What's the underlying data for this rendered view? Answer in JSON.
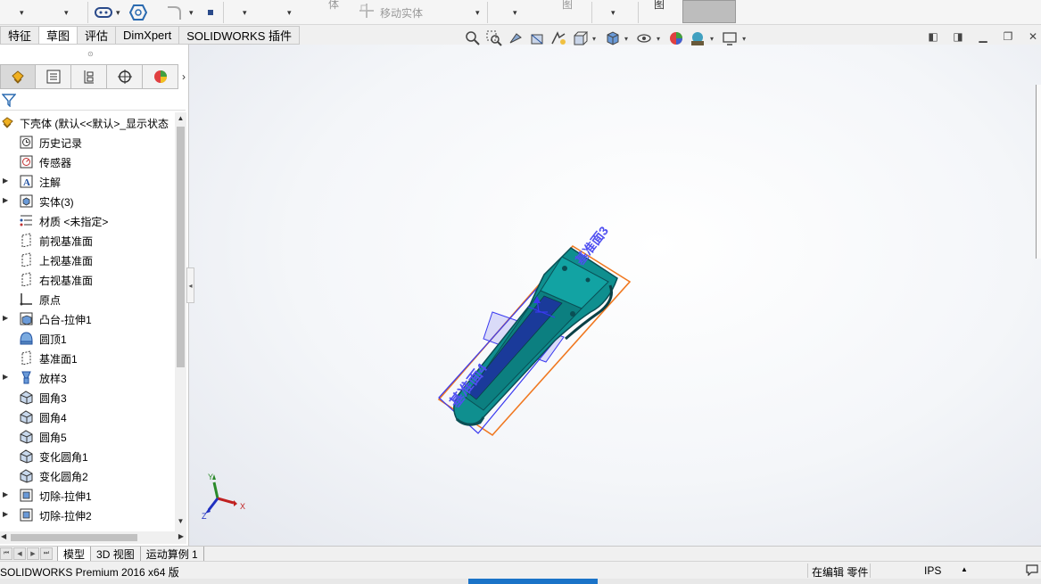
{
  "top_toolbar": {
    "move_body_label": "移动实体",
    "faded_label_1": "体",
    "faded_label_2": "图",
    "faded_label_3": "图"
  },
  "command_tabs": [
    "特征",
    "草图",
    "评估",
    "DimXpert",
    "SOLIDWORKS 插件"
  ],
  "active_command_tab": "草图",
  "feature_tree": {
    "root": "下壳体 (默认<<默认>_显示状态",
    "items": [
      {
        "label": "历史记录",
        "icon": "history-icon",
        "expandable": false
      },
      {
        "label": "传感器",
        "icon": "sensor-icon",
        "expandable": false
      },
      {
        "label": "注解",
        "icon": "annotation-icon",
        "expandable": true
      },
      {
        "label": "实体(3)",
        "icon": "solid-bodies-icon",
        "expandable": true
      },
      {
        "label": "材质 <未指定>",
        "icon": "material-icon",
        "expandable": false
      },
      {
        "label": "前视基准面",
        "icon": "plane-icon",
        "expandable": false
      },
      {
        "label": "上视基准面",
        "icon": "plane-icon",
        "expandable": false
      },
      {
        "label": "右视基准面",
        "icon": "plane-icon",
        "expandable": false
      },
      {
        "label": "原点",
        "icon": "origin-icon",
        "expandable": false
      },
      {
        "label": "凸台-拉伸1",
        "icon": "boss-extrude-icon",
        "expandable": true
      },
      {
        "label": "圆顶1",
        "icon": "dome-icon",
        "expandable": false
      },
      {
        "label": "基准面1",
        "icon": "plane-icon",
        "expandable": false
      },
      {
        "label": "放样3",
        "icon": "loft-icon",
        "expandable": true
      },
      {
        "label": "圆角3",
        "icon": "fillet-icon",
        "expandable": false
      },
      {
        "label": "圆角4",
        "icon": "fillet-icon",
        "expandable": false
      },
      {
        "label": "圆角5",
        "icon": "fillet-icon",
        "expandable": false
      },
      {
        "label": "变化圆角1",
        "icon": "fillet-icon",
        "expandable": false
      },
      {
        "label": "变化圆角2",
        "icon": "fillet-icon",
        "expandable": false
      },
      {
        "label": "切除-拉伸1",
        "icon": "cut-extrude-icon",
        "expandable": true
      },
      {
        "label": "切除-拉伸2",
        "icon": "cut-extrude-icon",
        "expandable": true
      }
    ]
  },
  "graphics": {
    "plane_label_front": "基准面4",
    "plane_label_back": "基准面3",
    "triad": {
      "x": "X",
      "y": "Y",
      "z": "Z"
    }
  },
  "bottom_tabs": [
    "模型",
    "3D 视图",
    "运动算例 1"
  ],
  "active_bottom_tab": "模型",
  "status_bar": {
    "app": "SOLIDWORKS Premium 2016 x64 版",
    "mode": "在编辑 零件",
    "units": "IPS"
  },
  "colors": {
    "part_body": "#0f8f8f",
    "part_dark": "#0a4f55",
    "plane_blue": "#3a3af0",
    "plane_orange": "#f07820",
    "accent_blue": "#1a73c8"
  }
}
